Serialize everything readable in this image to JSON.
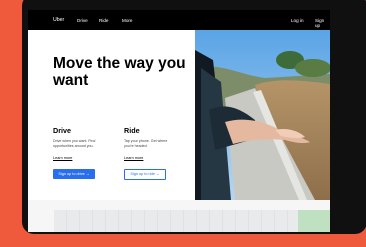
{
  "nav": {
    "brand": "Uber",
    "links": [
      "Drive",
      "Ride",
      "More"
    ],
    "login": "Log in",
    "signup": "Sign up"
  },
  "hero": {
    "headline": "Move the way you want"
  },
  "drive": {
    "title": "Drive",
    "description": "Drive when you want. Find opportunities around you.",
    "link": "Learn more",
    "button": "Sign up to drive →"
  },
  "ride": {
    "title": "Ride",
    "description": "Tap your phone. Get where you're headed.",
    "link": "Learn more",
    "button": "Sign up to ride →"
  },
  "colors": {
    "background": "#ef5a3c",
    "primary_button": "#276ef1",
    "nav": "#000000"
  }
}
